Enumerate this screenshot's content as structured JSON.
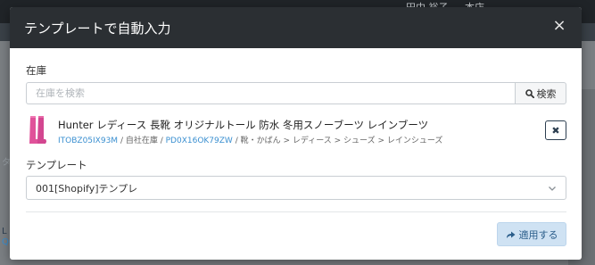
{
  "background": {
    "user_name": "田中 裕子",
    "store_name": "本店",
    "left_partial": [
      "L",
      "QC"
    ],
    "left_partial_2": "タ"
  },
  "modal": {
    "title": "テンプレートで自動入力",
    "close_glyph": "×",
    "inventory_label": "在庫",
    "search_placeholder": "在庫を検索",
    "search_button_label": "検索",
    "product": {
      "name": "Hunter レディース 長靴 オリジナルトール 防水 冬用スノーブーツ レインブーツ",
      "sku": "ITOBZ05IX93M",
      "sep1": " / ",
      "warehouse": "自社在庫",
      "sep2": " / ",
      "code": "PD0X16OK79ZW",
      "sep3": " / ",
      "category_path": "靴・かばん > レディース > シューズ > レインシューズ",
      "remove_glyph": "✖"
    },
    "template_label": "テンプレート",
    "template_selected": "001[Shopify]テンプレ",
    "apply_button_label": "適用する"
  },
  "colors": {
    "header_bg": "#2b2f33",
    "link": "#3a8fd0",
    "apply_bg": "#cfe2f3",
    "product_pink": "#e0529a"
  }
}
